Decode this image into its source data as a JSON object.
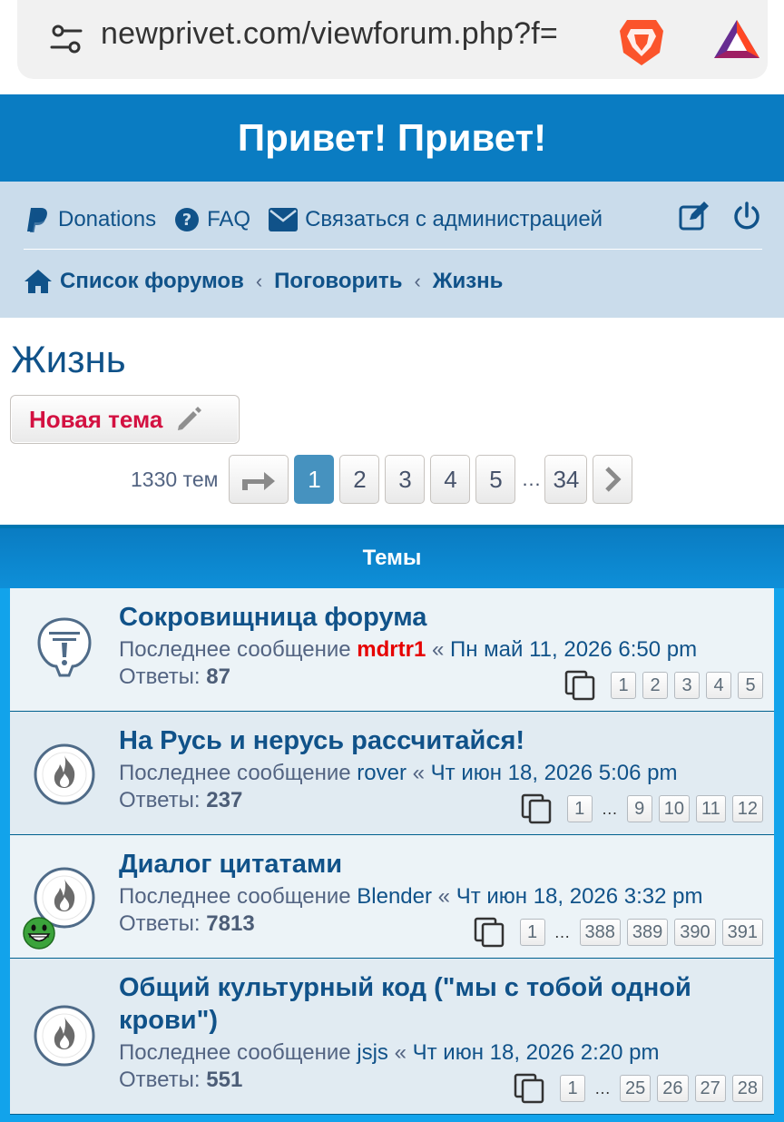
{
  "browser": {
    "url": "newprivet.com/viewforum.php?f="
  },
  "header": {
    "site_title": "Привет! Привет!"
  },
  "nav": {
    "donations": "Donations",
    "faq": "FAQ",
    "contact": "Связаться с администрацией"
  },
  "breadcrumbs": {
    "home": "Список форумов",
    "sep1": "‹",
    "parent": "Поговорить",
    "sep2": "‹",
    "current": "Жизнь"
  },
  "forum": {
    "title": "Жизнь",
    "new_topic_label": "Новая тема",
    "topic_count": "1330 тем"
  },
  "pagination": {
    "pages": [
      "1",
      "2",
      "3",
      "4",
      "5"
    ],
    "ellipsis": "…",
    "last": "34",
    "active": "1"
  },
  "topics_header": "Темы",
  "topics": [
    {
      "title": "Сокровищница форума",
      "last_label": "Последнее сообщение",
      "author": "mdrtr1",
      "date_prefix": "«",
      "date": "Пн май 11, 2026 6:50 pm",
      "replies_label": "Ответы:",
      "replies": "87",
      "pages": [
        "1",
        "2",
        "3",
        "4",
        "5"
      ]
    },
    {
      "title": "На Русь и нерусь рассчитайся!",
      "last_label": "Последнее сообщение",
      "author": "rover",
      "date_prefix": "«",
      "date": "Чт июн 18, 2026 5:06 pm",
      "replies_label": "Ответы:",
      "replies": "237",
      "pages_first": "1",
      "pages_ellipsis": "…",
      "pages_tail": [
        "9",
        "10",
        "11",
        "12"
      ]
    },
    {
      "title": "Диалог цитатами",
      "last_label": "Последнее сообщение",
      "author": "Blender",
      "date_prefix": "«",
      "date": "Чт июн 18, 2026 3:32 pm",
      "replies_label": "Ответы:",
      "replies": "7813",
      "pages_first": "1",
      "pages_ellipsis": "…",
      "pages_tail": [
        "388",
        "389",
        "390",
        "391"
      ]
    },
    {
      "title": "Общий культурный код (\"мы с тобой одной крови\")",
      "last_label": "Последнее сообщение",
      "author": "jsjs",
      "date_prefix": "«",
      "date": "Чт июн 18, 2026 2:20 pm",
      "replies_label": "Ответы:",
      "replies": "551",
      "pages_first": "1",
      "pages_ellipsis": "…",
      "pages_tail": [
        "25",
        "26",
        "27",
        "28"
      ]
    }
  ],
  "colors": {
    "header_blue": "#0a7cc2",
    "nav_bg": "#cadceb",
    "link_blue": "#105289",
    "new_topic_red": "#d31141",
    "admin_red": "#e60000"
  },
  "icons": [
    "tune-icon",
    "brave-lion-icon",
    "bat-triangle-icon",
    "paypal-icon",
    "question-circle-icon",
    "envelope-icon",
    "edit-icon",
    "power-icon",
    "home-icon",
    "pencil-icon",
    "reply-arrow-icon",
    "chevron-right-icon",
    "announcement-icon",
    "hot-topic-icon",
    "pages-icon",
    "grin-smiley-icon"
  ]
}
